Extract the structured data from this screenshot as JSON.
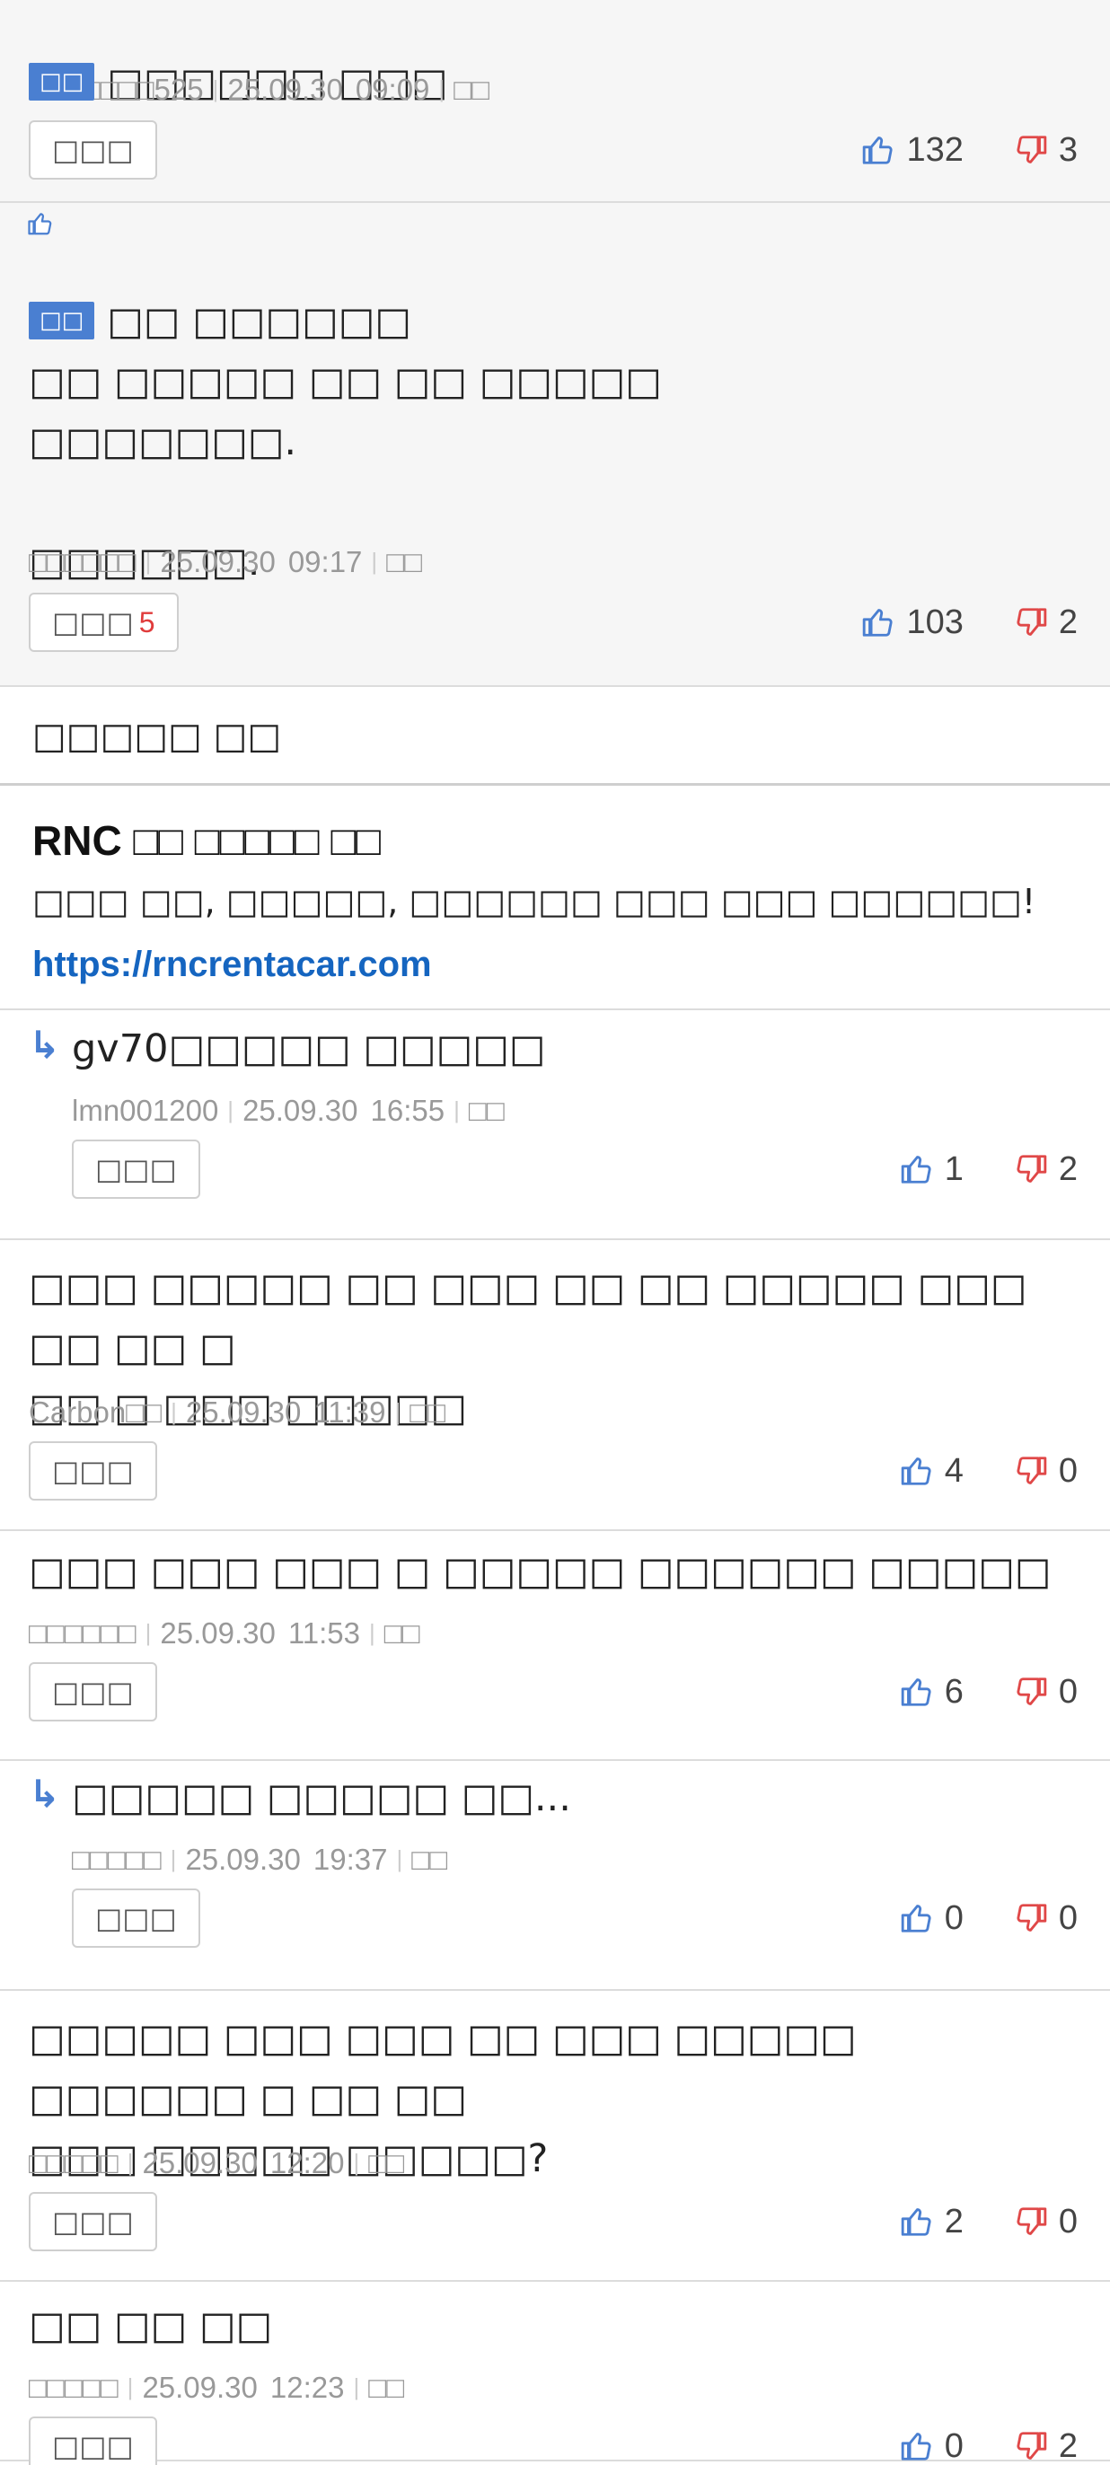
{
  "comments_best": [
    {
      "badge": "□□",
      "text": "□□□□□□ □□□",
      "author": "□□□□□□□525",
      "date": "25.09.30",
      "time": "09:09",
      "action": "□□",
      "reply_label": "□□□",
      "reply_count": "",
      "up": "132",
      "down": "3"
    },
    {
      "badge": "□□",
      "text": "□□ □□□□□□\n□□ □□□□□ □□ □□ □□□□□\n□□□□□□□.\n\n□□□□□□.",
      "author": "□□□□□□",
      "date": "25.09.30",
      "time": "09:17",
      "action": "□□",
      "reply_label": "□□□",
      "reply_count": "5",
      "up": "103",
      "down": "2"
    }
  ],
  "notice": {
    "label": "□□□□□ □□"
  },
  "ad": {
    "title": "RNC □□ □□□□□ □□",
    "desc": "□□□ □□, □□□□□, □□□□□□ □□□ □□□ □□□□□□!",
    "link": "https://rncrentacar.com"
  },
  "comments": [
    {
      "is_reply": true,
      "arrow": "↳",
      "text": "gv70□□□□□ □□□□□",
      "author": "lmn001200",
      "date": "25.09.30",
      "time": "16:55",
      "action": "□□",
      "reply_label": "□□□",
      "up": "1",
      "down": "2"
    },
    {
      "is_reply": false,
      "text": "□□□ □□□□□ □□ □□□ □□ □□ □□□□□ □□□ □□ □□ □\n□□ □ □□□ □□□□□",
      "author": "Carbon□□",
      "date": "25.09.30",
      "time": "11:39",
      "action": "□□",
      "reply_label": "□□□",
      "up": "4",
      "down": "0"
    },
    {
      "is_reply": false,
      "text": "□□□ □□□ □□□ □ □□□□□ □□□□□□ □□□□□",
      "author": "□□□□□□",
      "date": "25.09.30",
      "time": "11:53",
      "action": "□□",
      "reply_label": "□□□",
      "up": "6",
      "down": "0"
    },
    {
      "is_reply": true,
      "arrow": "↳",
      "text": "□□□□□ □□□□□ □□...",
      "author": "□□□□□",
      "date": "25.09.30",
      "time": "19:37",
      "action": "□□",
      "reply_label": "□□□",
      "up": "0",
      "down": "0"
    },
    {
      "is_reply": false,
      "text": "□□□□□ □□□ □□□ □□ □□□ □□□□□ □□□□□□ □ □□ □□\n□□□ □□□□□ □□□□□?",
      "author": "□□□□□",
      "date": "25.09.30",
      "time": "12:20",
      "action": "□□",
      "reply_label": "□□□",
      "up": "2",
      "down": "0"
    },
    {
      "is_reply": false,
      "text": "□□ □□ □□",
      "author": "□□□□□",
      "date": "25.09.30",
      "time": "12:23",
      "action": "□□",
      "reply_label": "□□□",
      "up": "0",
      "down": "2"
    }
  ],
  "colors": {
    "accent": "#4a7fd1",
    "downvote": "#e04848",
    "link": "#1565c0",
    "best_bg": "#f6f6f6"
  },
  "icons": {
    "up": "thumbs-up-icon",
    "down": "thumbs-down-icon",
    "reply_arrow": "reply-arrow-icon"
  }
}
